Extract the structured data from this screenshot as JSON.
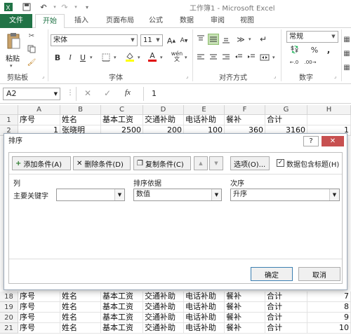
{
  "window": {
    "title": "工作簿1 - Microsoft Excel"
  },
  "tabs": [
    {
      "label": "文件"
    },
    {
      "label": "开始"
    },
    {
      "label": "插入"
    },
    {
      "label": "页面布局"
    },
    {
      "label": "公式"
    },
    {
      "label": "数据"
    },
    {
      "label": "审阅"
    },
    {
      "label": "视图"
    }
  ],
  "ribbon": {
    "clipboard": {
      "paste_label": "粘贴",
      "group_label": "剪贴板"
    },
    "font": {
      "name": "宋体",
      "size": "11",
      "group_label": "字体",
      "bold": "B",
      "italic": "I",
      "underline": "U",
      "grow": "A",
      "shrink": "A",
      "wen": "wén"
    },
    "alignment": {
      "group_label": "对齐方式"
    },
    "number": {
      "format": "常规",
      "percent": "%",
      "comma": ",",
      "group_label": "数字"
    }
  },
  "formula_bar": {
    "name_box": "A2",
    "fx": "fx",
    "value": "1"
  },
  "grid": {
    "columns": [
      "A",
      "B",
      "C",
      "D",
      "E",
      "F",
      "G",
      "H"
    ],
    "header_row": [
      "序号",
      "姓名",
      "基本工资",
      "交通补助",
      "电话补助",
      "餐补",
      "合计",
      ""
    ],
    "row2": {
      "num": "2",
      "a": "1",
      "b": "张晓明",
      "c": "2500",
      "d": "200",
      "e": "100",
      "f": "360",
      "g": "3160",
      "h": "1"
    },
    "bottom_rows": [
      {
        "num": "18",
        "h": "7"
      },
      {
        "num": "19",
        "h": "8"
      },
      {
        "num": "20",
        "h": "9"
      },
      {
        "num": "21",
        "h": "10"
      }
    ],
    "row1_num": "1"
  },
  "dialog": {
    "title": "排序",
    "help": "?",
    "close": "✕",
    "add_label": "添加条件(A)",
    "delete_label": "删除条件(D)",
    "copy_label": "复制条件(C)",
    "options_label": "选项(O)...",
    "has_headers_label": "数据包含标题(H)",
    "col_header": "列",
    "sorton_header": "排序依据",
    "order_header": "次序",
    "row_label": "主要关键字",
    "column_value": "",
    "sorton_value": "数值",
    "order_value": "升序",
    "ok_label": "确定",
    "cancel_label": "取消"
  },
  "colors": {
    "accent": "#217346",
    "dialog_border": "#9aa8b8"
  }
}
